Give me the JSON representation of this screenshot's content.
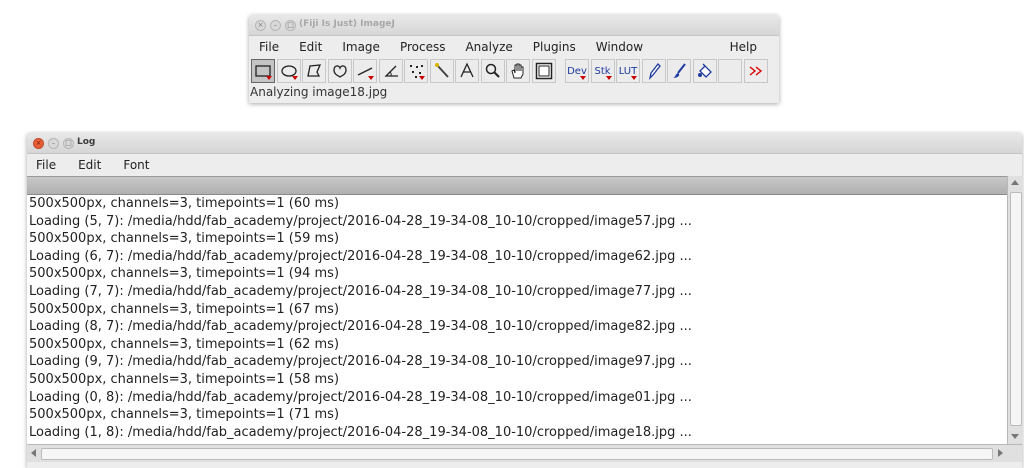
{
  "imagej": {
    "title": "(Fiji Is Just) ImageJ",
    "menu": [
      "File",
      "Edit",
      "Image",
      "Process",
      "Analyze",
      "Plugins",
      "Window",
      "Help"
    ],
    "tools": [
      {
        "name": "rectangle-tool-icon",
        "selected": true
      },
      {
        "name": "oval-tool-icon"
      },
      {
        "name": "polygon-tool-icon"
      },
      {
        "name": "freehand-tool-icon"
      },
      {
        "name": "line-tool-icon"
      },
      {
        "name": "angle-tool-icon"
      },
      {
        "name": "multipoint-tool-icon"
      },
      {
        "name": "wand-tool-icon"
      },
      {
        "name": "text-tool-icon"
      },
      {
        "name": "magnifier-tool-icon"
      },
      {
        "name": "hand-tool-icon"
      },
      {
        "name": "color-picker-tool-icon"
      }
    ],
    "menu_tools": [
      "Dev",
      "Stk",
      "LUT"
    ],
    "status": "Analyzing image18.jpg"
  },
  "log": {
    "title": "Log",
    "menu": [
      "File",
      "Edit",
      "Font"
    ],
    "lines": [
      "500x500px, channels=3, timepoints=1 (60 ms)",
      "Loading (5, 7): /media/hdd/fab_academy/project/2016-04-28_19-34-08_10-10/cropped/image57.jpg ...",
      "500x500px, channels=3, timepoints=1 (59 ms)",
      "Loading (6, 7): /media/hdd/fab_academy/project/2016-04-28_19-34-08_10-10/cropped/image62.jpg ...",
      "500x500px, channels=3, timepoints=1 (94 ms)",
      "Loading (7, 7): /media/hdd/fab_academy/project/2016-04-28_19-34-08_10-10/cropped/image77.jpg ...",
      "500x500px, channels=3, timepoints=1 (67 ms)",
      "Loading (8, 7): /media/hdd/fab_academy/project/2016-04-28_19-34-08_10-10/cropped/image82.jpg ...",
      "500x500px, channels=3, timepoints=1 (62 ms)",
      "Loading (9, 7): /media/hdd/fab_academy/project/2016-04-28_19-34-08_10-10/cropped/image97.jpg ...",
      "500x500px, channels=3, timepoints=1 (58 ms)",
      "Loading (0, 8): /media/hdd/fab_academy/project/2016-04-28_19-34-08_10-10/cropped/image01.jpg ...",
      "500x500px, channels=3, timepoints=1 (71 ms)",
      "Loading (1, 8): /media/hdd/fab_academy/project/2016-04-28_19-34-08_10-10/cropped/image18.jpg ..."
    ]
  }
}
